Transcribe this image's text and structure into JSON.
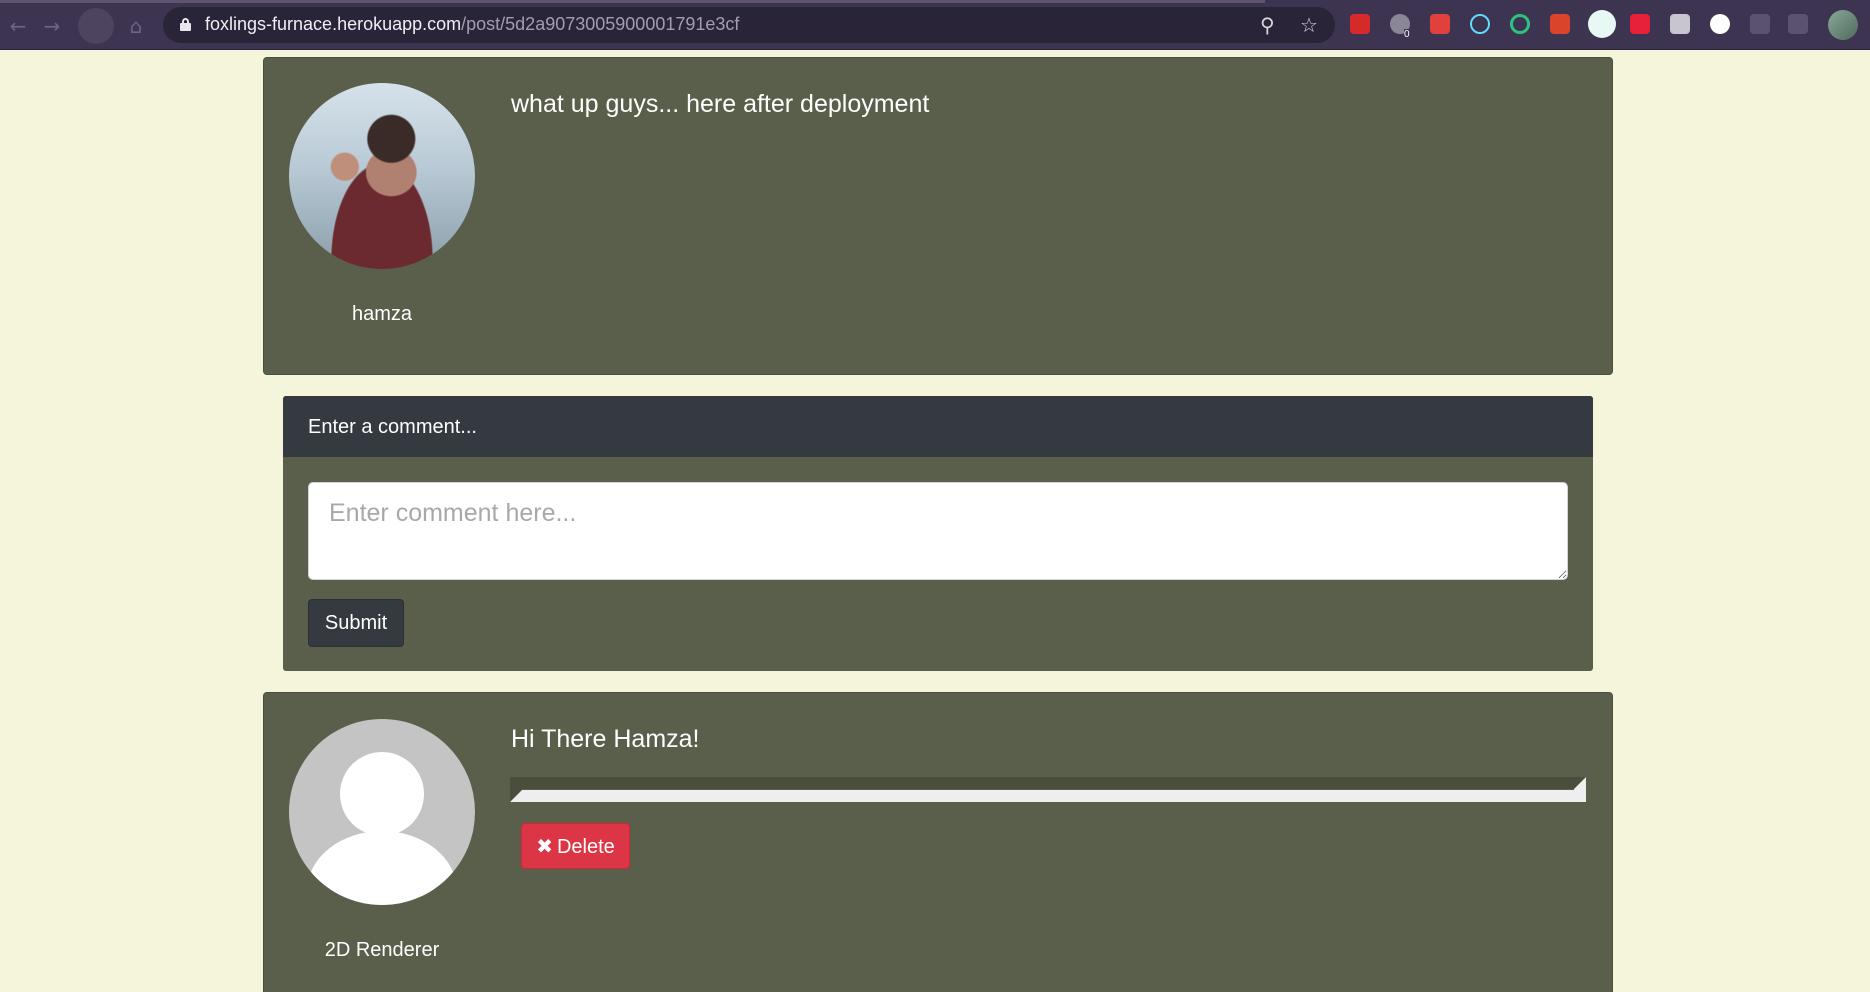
{
  "browser": {
    "url_domain": "foxlings-furnace.herokuapp.com",
    "url_path": "/post/5d2a9073005900001791e3cf",
    "icons": {
      "back": "arrow-left-icon",
      "forward": "arrow-right-icon",
      "home": "home-icon",
      "lock": "lock-icon",
      "key": "key-icon",
      "star": "star-icon"
    },
    "extension_badge": "0"
  },
  "post": {
    "text": "what up guys... here after deployment",
    "author": "hamza"
  },
  "comment_form": {
    "header": "Enter a comment...",
    "placeholder": "Enter comment here...",
    "submit_label": "Submit"
  },
  "comments": [
    {
      "text": "Hi There Hamza!",
      "author": "2D Renderer",
      "delete_label": "Delete",
      "delete_icon": "x-icon"
    }
  ],
  "colors": {
    "page_background": "#f5f5dc",
    "card_background": "#5a5f4b",
    "header_dark": "#343a40",
    "danger": "#dc3545"
  }
}
